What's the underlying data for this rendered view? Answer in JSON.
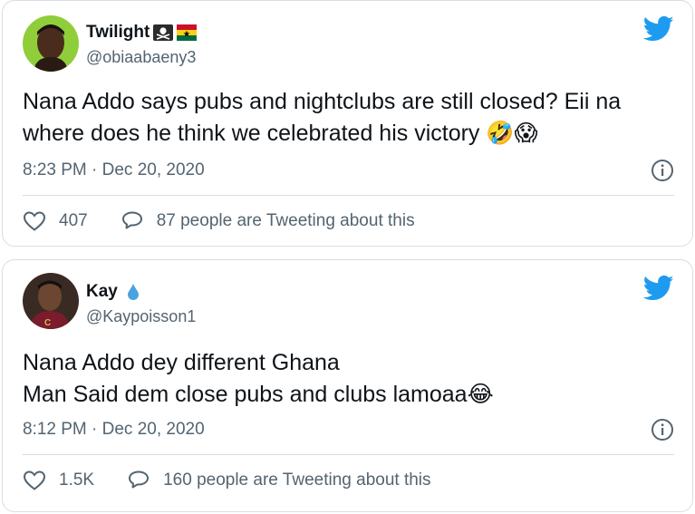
{
  "accent_color": "#1d9bf0",
  "tweets": [
    {
      "name": "Twilight",
      "name_badges": [
        "skull-crossbones-flag-icon",
        "ghana-flag-icon"
      ],
      "handle": "@obiaabaeny3",
      "text": "Nana Addo says pubs and nightclubs are still closed? Eii na where does he think we celebrated his victory 🤣😱",
      "timestamp": "8:23 PM · Dec 20, 2020",
      "likes": "407",
      "conversation": "87 people are Tweeting about this"
    },
    {
      "name": "Kay",
      "name_badges": [
        "droplet-icon"
      ],
      "handle": "@Kaypoisson1",
      "text": "Nana Addo dey different Ghana\nMan Said dem close pubs and clubs lamoaa😂",
      "timestamp": "8:12 PM · Dec 20, 2020",
      "likes": "1.5K",
      "conversation": "160 people are Tweeting about this"
    }
  ]
}
